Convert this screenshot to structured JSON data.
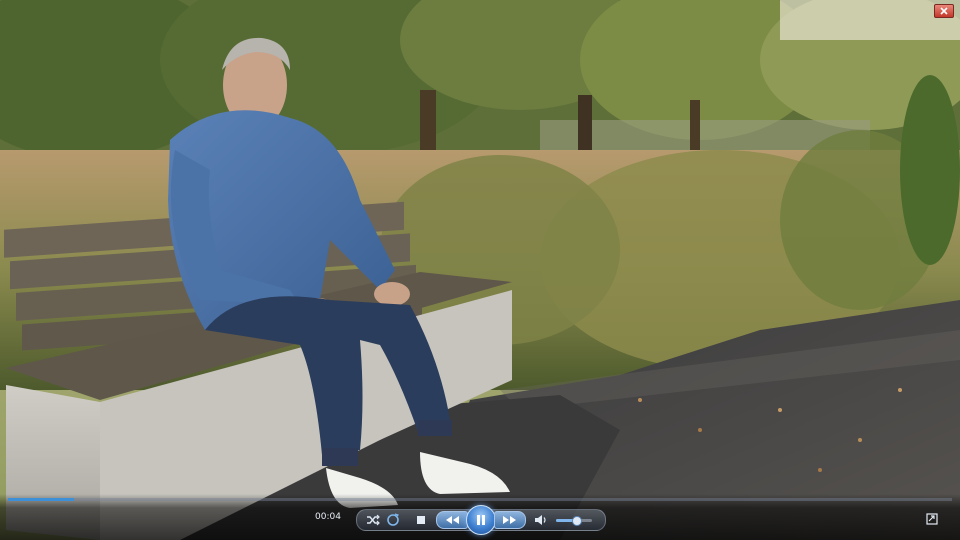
{
  "player": {
    "elapsed_time": "00:04",
    "progress_fraction": 0.07,
    "volume_fraction": 0.55,
    "state": "playing"
  },
  "icons": {
    "close": "close-icon",
    "shuffle": "shuffle-icon",
    "repeat": "repeat-icon",
    "stop": "stop-icon",
    "previous": "previous-icon",
    "pause": "pause-icon",
    "next": "next-icon",
    "volume": "speaker-icon",
    "switch_view": "switch-to-library-icon"
  },
  "colors": {
    "accent": "#3d8fd8",
    "close": "#c3382a"
  }
}
